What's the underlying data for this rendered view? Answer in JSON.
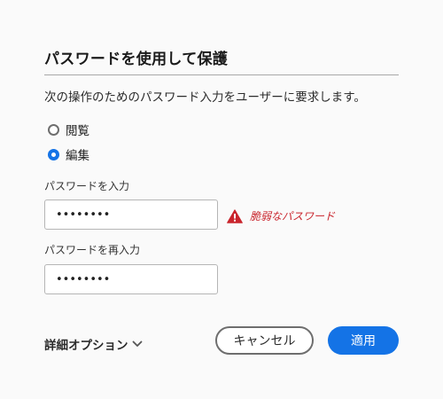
{
  "dialog": {
    "title": "パスワードを使用して保護",
    "description": "次の操作のためのパスワード入力をユーザーに要求します。"
  },
  "options": {
    "view_label": "閲覧",
    "edit_label": "編集",
    "selected": "編集"
  },
  "password": {
    "label": "パスワードを入力",
    "value": "••••••••",
    "strength_warning": "脆弱なパスワード"
  },
  "reenter": {
    "label": "パスワードを再入力",
    "value": "••••••••"
  },
  "footer": {
    "more_options_label": "詳細オプション",
    "cancel_label": "キャンセル",
    "apply_label": "適用"
  },
  "colors": {
    "accent": "#1473e6",
    "warning": "#c9252d",
    "background": "#fafafa"
  },
  "icons": {
    "warning": "warning-triangle-icon",
    "chevron": "chevron-down-icon"
  }
}
